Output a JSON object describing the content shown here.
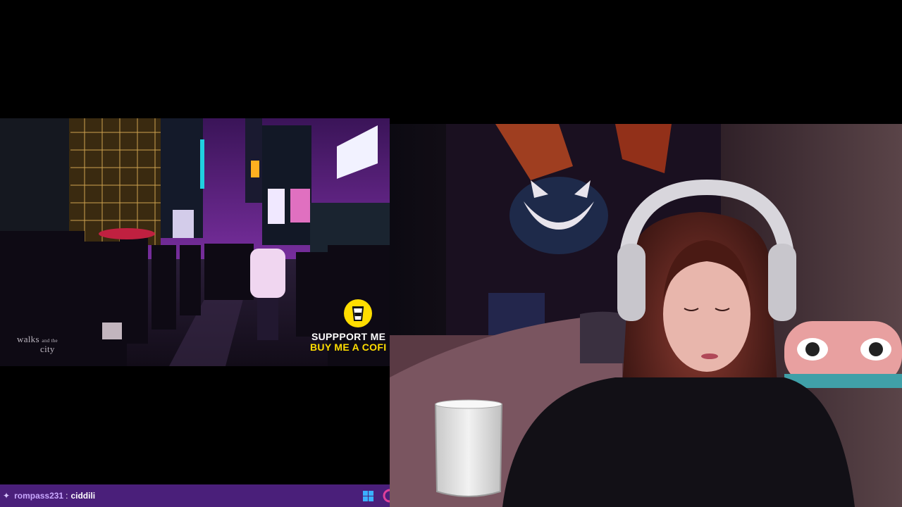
{
  "video": {
    "watermark_main": "walks",
    "watermark_small": "and the",
    "watermark_line2": "city",
    "support_line1": "SUPPPORT ME",
    "support_line2": "BUY ME A COFI"
  },
  "chat": {
    "username": "rompass231",
    "separator": ":",
    "message": "ciddili"
  },
  "icons": {
    "chat_prefix": "sparkle-icon",
    "taskbar": "windows-icon",
    "overlay": "coffee-cup-icon"
  },
  "colors": {
    "chat_bar": "#4a1f7a",
    "chat_username": "#c9a8ff",
    "support_accent": "#ffdd00"
  }
}
